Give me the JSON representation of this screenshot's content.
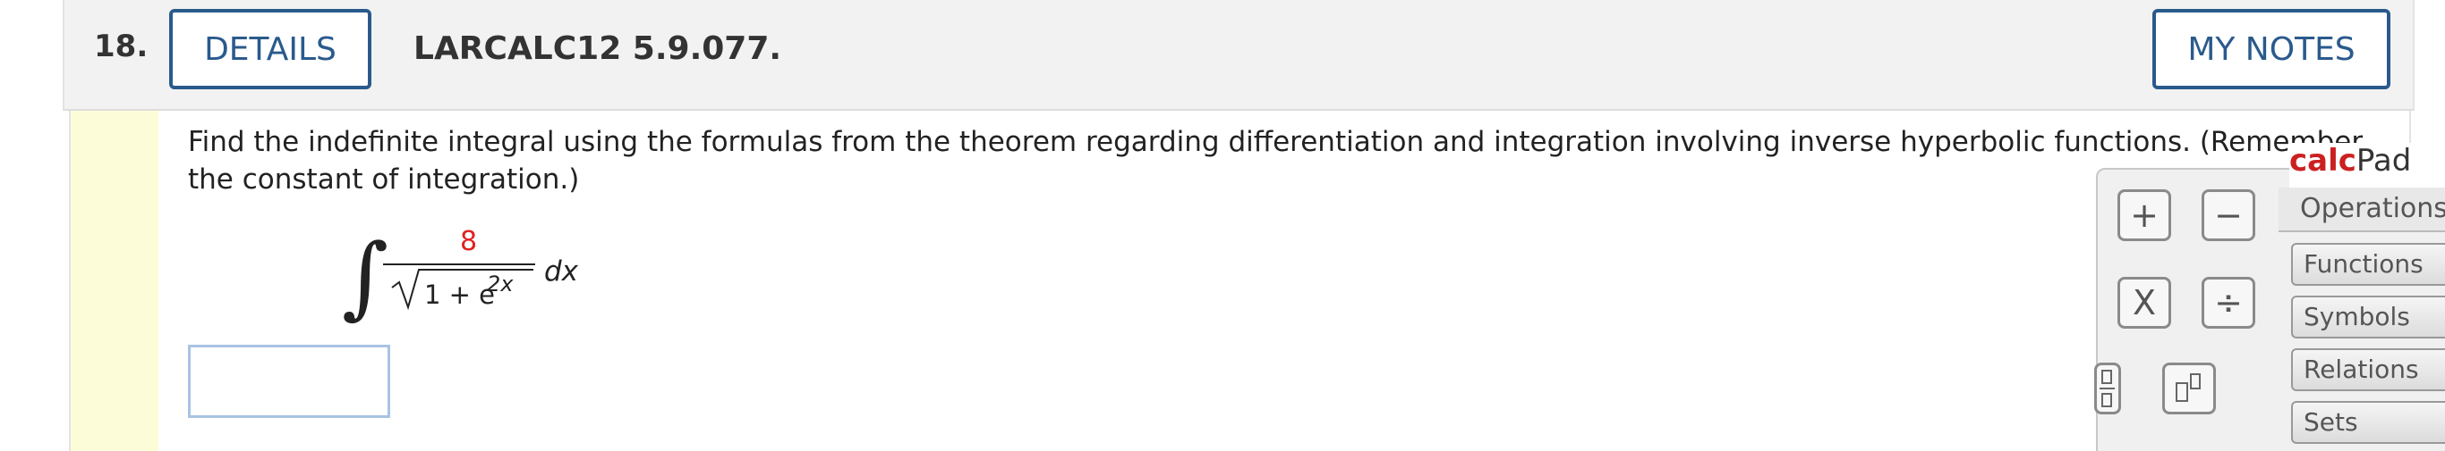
{
  "question": {
    "number": "18.",
    "details_label": "DETAILS",
    "reference": "LARCALC12 5.9.077.",
    "notes_label": "MY NOTES"
  },
  "prompt": {
    "text": "Find the indefinite integral using the formulas from the theorem regarding differentiation and integration involving inverse hyperbolic functions. (Remember the constant of integration.)"
  },
  "integral": {
    "sign": "∫",
    "numerator": "8",
    "radicand": "1 + e",
    "exponent": "2x",
    "differential": "dx"
  },
  "answer": {
    "value": ""
  },
  "calcpad": {
    "title_calc": "calc",
    "title_pad": "Pad",
    "keys": {
      "plus": "+",
      "minus": "−",
      "times": "X",
      "divide": "÷"
    },
    "tabs": {
      "operations": "Operations",
      "functions": "Functions",
      "symbols": "Symbols",
      "relations": "Relations",
      "sets": "Sets"
    }
  },
  "colors": {
    "accent": "#2a5a8c",
    "numerator": "#e02020",
    "calc_brand": "#cc2020",
    "left_bar": "#fcfcd8"
  }
}
